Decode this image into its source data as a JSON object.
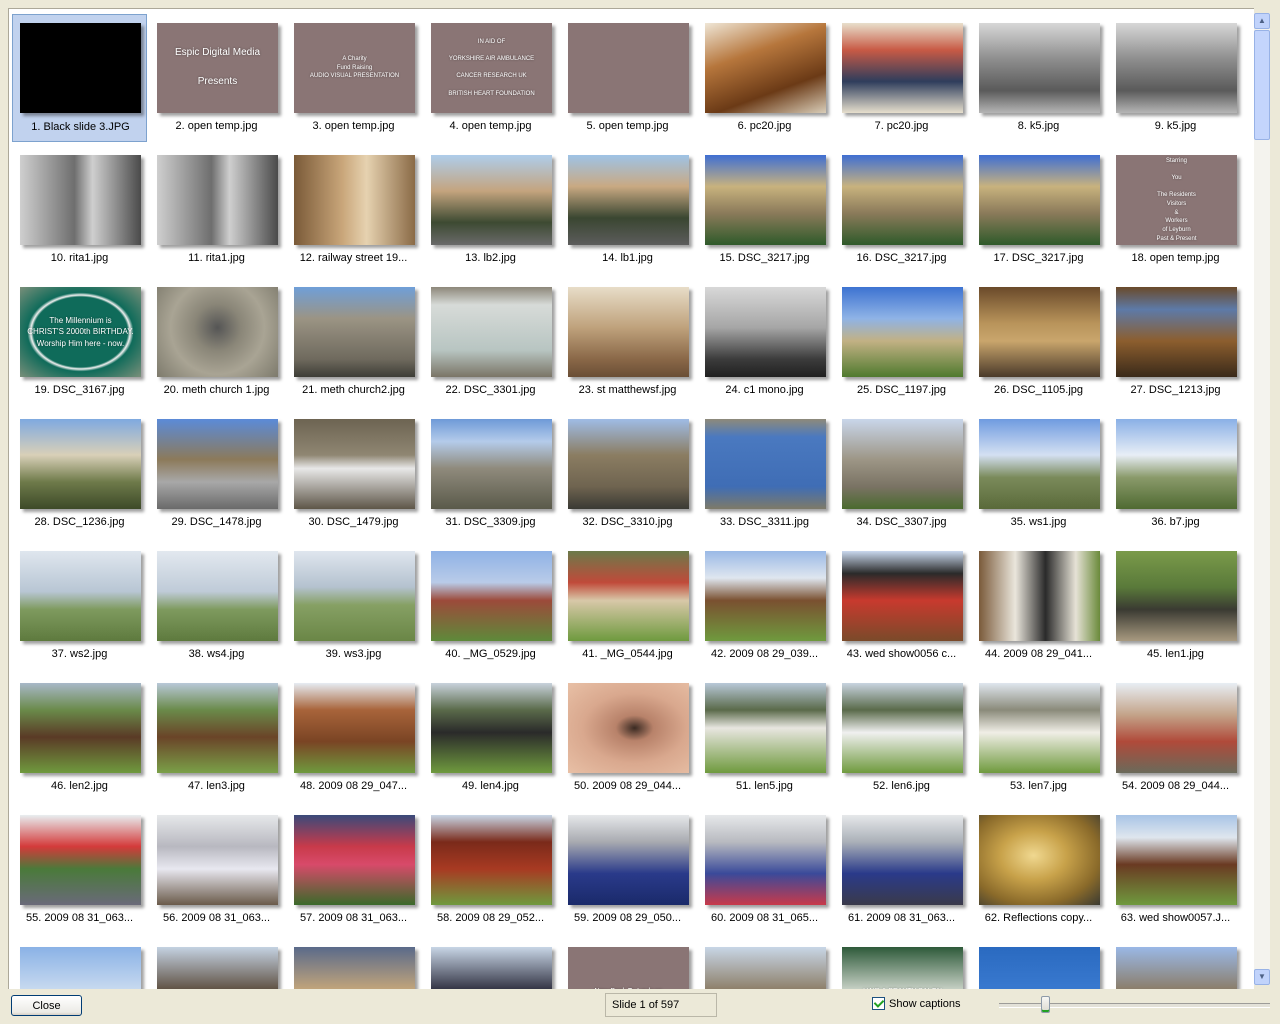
{
  "gallery": {
    "items": [
      {
        "caption": "1. Black slide 3.JPG",
        "selected": true,
        "thumb": {
          "bg": "#000000"
        }
      },
      {
        "caption": "2. open temp.jpg",
        "thumb": {
          "bg": "#8a7575",
          "text": "Espic Digital Media\n\nPresents",
          "font_size": 10
        }
      },
      {
        "caption": "3. open temp.jpg",
        "thumb": {
          "bg": "#8a7575",
          "text": "A Charity\nFund Raising\nAUDIO VISUAL PRESENTATION",
          "font_size": 6
        }
      },
      {
        "caption": "4. open temp.jpg",
        "thumb": {
          "bg": "#8a7575",
          "text": "IN AID OF\n\nYORKSHIRE AIR AMBULANCE\n\nCANCER RESEARCH UK\n\nBRITISH HEART FOUNDATION",
          "font_size": 6
        }
      },
      {
        "caption": "5. open temp.jpg",
        "thumb": {
          "bg": "#8a7575"
        }
      },
      {
        "caption": "6. pc20.jpg",
        "thumb": {
          "bg": "linear-gradient(160deg,#efe6d6 0%,#b6763c 35%,#6b3a16 70%,#d9cdb8 100%)"
        }
      },
      {
        "caption": "7. pc20.jpg",
        "thumb": {
          "bg": "linear-gradient(180deg,#e8dfcc 0%,#c85a45 30%,#2e3d5c 65%,#e7dfcd 100%)"
        }
      },
      {
        "caption": "8. k5.jpg",
        "thumb": {
          "bg": "linear-gradient(180deg,#d7d7d7 0%,#8e8e8e 40%,#5a5a5a 75%,#b5b5b5 100%)"
        }
      },
      {
        "caption": "9. k5.jpg",
        "thumb": {
          "bg": "linear-gradient(180deg,#d7d7d7 0%,#8e8e8e 40%,#5a5a5a 75%,#b5b5b5 100%)"
        }
      },
      {
        "caption": "10. rita1.jpg",
        "thumb": {
          "bg": "linear-gradient(90deg,#cfcfcf 0%,#6e6e6e 45%,#cfcfcf 60%,#4a4a4a 100%)"
        }
      },
      {
        "caption": "11. rita1.jpg",
        "thumb": {
          "bg": "linear-gradient(90deg,#cfcfcf 0%,#6e6e6e 45%,#cfcfcf 60%,#4a4a4a 100%)"
        }
      },
      {
        "caption": "12. railway street 19...",
        "thumb": {
          "bg": "linear-gradient(90deg,#7a5a38 0%,#c9a67a 40%,#e6d2b0 60%,#8a6a46 100%)"
        }
      },
      {
        "caption": "13. lb2.jpg",
        "thumb": {
          "bg": "linear-gradient(180deg,#aecdea 0%,#c4a47e 40%,#3d4a32 75%,#6a6a6a 100%)"
        }
      },
      {
        "caption": "14. lb1.jpg",
        "thumb": {
          "bg": "linear-gradient(180deg,#9ec3e6 0%,#c9a982 35%,#3a4631 70%,#5c5c5c 100%)"
        }
      },
      {
        "caption": "15. DSC_3217.jpg",
        "thumb": {
          "bg": "linear-gradient(180deg,#3f6fd2 0%,#c8b27e 35%,#8a7a5a 65%,#2e5a2a 100%)"
        }
      },
      {
        "caption": "16. DSC_3217.jpg",
        "thumb": {
          "bg": "linear-gradient(180deg,#3f6fd2 0%,#c8b27e 35%,#8a7a5a 65%,#2e5a2a 100%)"
        }
      },
      {
        "caption": "17. DSC_3217.jpg",
        "thumb": {
          "bg": "linear-gradient(180deg,#3f6fd2 0%,#c8b27e 35%,#8a7a5a 65%,#2e5a2a 100%)"
        }
      },
      {
        "caption": "18. open temp.jpg",
        "thumb": {
          "bg": "#8a7575",
          "text": "Starring\n\nYou\n\nThe Residents\nVisitors\n&\nWorkers\nof Leyburn\nPast & Present",
          "font_size": 6
        }
      },
      {
        "caption": "19. DSC_3167.jpg",
        "thumb": {
          "bg": "radial-gradient(ellipse at 50% 50%,#0f6b5a 0%,#0f6b5a 55%,#f0f0f0 58%,#0f6b5a 62%,#7a8f7a 100%)",
          "text": "The Millennium is\nCHRIST'S 2000th BIRTHDAY.\nWorship Him here - now.",
          "font_size": 8
        }
      },
      {
        "caption": "20. meth church 1.jpg",
        "thumb": {
          "bg": "radial-gradient(circle at 50% 45%,#555 0%,#8a8678 30%,#a9a494 60%,#7d7a6c 100%)"
        }
      },
      {
        "caption": "21. meth church2.jpg",
        "thumb": {
          "bg": "linear-gradient(180deg,#6f9fd8 0%,#9b9484 35%,#6f6a5e 80%,#3d3d36 100%)"
        }
      },
      {
        "caption": "22. DSC_3301.jpg",
        "thumb": {
          "bg": "linear-gradient(180deg,#8d877a 0%,#d7dbd8 20%,#b8c5c2 70%,#7a7466 100%)"
        }
      },
      {
        "caption": "23. st matthewsf.jpg",
        "thumb": {
          "bg": "linear-gradient(180deg,#e8ddc8 0%,#bfa27c 45%,#8a6848 80%,#6a4e36 100%)"
        }
      },
      {
        "caption": "24. c1 mono.jpg",
        "thumb": {
          "bg": "linear-gradient(180deg,#d8d8d8 0%,#a6a6a6 45%,#3c3c3c 80%,#202020 100%)"
        }
      },
      {
        "caption": "25. DSC_1197.jpg",
        "thumb": {
          "bg": "linear-gradient(180deg,#3d73d1 0%,#8fb3e6 35%,#c2b184 60%,#4f7a2e 100%)"
        }
      },
      {
        "caption": "26. DSC_1105.jpg",
        "thumb": {
          "bg": "linear-gradient(180deg,#6a4a2a 0%,#b8935a 40%,#c9a56c 60%,#4a3a2a 100%)"
        }
      },
      {
        "caption": "27. DSC_1213.jpg",
        "thumb": {
          "bg": "linear-gradient(180deg,#6a4a2a 0%,#5d7aa8 25%,#8c5e2e 60%,#3a2a1a 100%)"
        }
      },
      {
        "caption": "28. DSC_1236.jpg",
        "thumb": {
          "bg": "linear-gradient(180deg,#7fa9e0 0%,#d9d0b8 40%,#6e7a4a 70%,#3d4a28 100%)"
        }
      },
      {
        "caption": "29. DSC_1478.jpg",
        "thumb": {
          "bg": "linear-gradient(180deg,#5b8bd8 0%,#8c7a5a 45%,#a8a8a8 70%,#6a6a6a 100%)"
        }
      },
      {
        "caption": "30. DSC_1479.jpg",
        "thumb": {
          "bg": "linear-gradient(180deg,#6d6452 0%,#8f8672 40%,#e8e8e8 55%,#5e5648 100%)"
        }
      },
      {
        "caption": "31. DSC_3309.jpg",
        "thumb": {
          "bg": "linear-gradient(180deg,#6e9ad8 0%,#b4cbea 25%,#8f8a7c 55%,#5a5a4a 100%)"
        }
      },
      {
        "caption": "32. DSC_3310.jpg",
        "thumb": {
          "bg": "linear-gradient(180deg,#9fbce6 0%,#8b7d62 40%,#6f6450 75%,#3a3a34 100%)"
        }
      },
      {
        "caption": "33. DSC_3311.jpg",
        "thumb": {
          "bg": "linear-gradient(180deg,#8e8a7a 0%,#4a79c0 20%,#3f6db5 75%,#7e7a68 100%)"
        }
      },
      {
        "caption": "34. DSC_3307.jpg",
        "thumb": {
          "bg": "linear-gradient(180deg,#c9d6ea 0%,#9d9686 45%,#7a7364 75%,#4a6a2e 100%)"
        }
      },
      {
        "caption": "35. ws1.jpg",
        "thumb": {
          "bg": "linear-gradient(180deg,#6f9be0 0%,#d4e0f2 40%,#7a8a5a 65%,#5a6a3a 100%)"
        }
      },
      {
        "caption": "36. b7.jpg",
        "thumb": {
          "bg": "linear-gradient(180deg,#8ab0e6 0%,#e8eef6 40%,#8a9a6a 65%,#4f6a32 100%)"
        }
      },
      {
        "caption": "37. ws2.jpg",
        "thumb": {
          "bg": "linear-gradient(180deg,#dfe6ee 0%,#b8c6d4 45%,#7e9a5e 65%,#5e7a3e 100%)"
        }
      },
      {
        "caption": "38. ws4.jpg",
        "thumb": {
          "bg": "linear-gradient(180deg,#e2e8ef 0%,#bfcbd8 45%,#7e9a5e 65%,#5e7a3e 100%)"
        }
      },
      {
        "caption": "39. ws3.jpg",
        "thumb": {
          "bg": "linear-gradient(180deg,#dfe6ee 0%,#b4c2cf 40%,#86a064 60%,#6a8646 100%)"
        }
      },
      {
        "caption": "40. _MG_0529.jpg",
        "thumb": {
          "bg": "linear-gradient(180deg,#8fb2e6 0%,#b9cbe8 35%,#9c4a3a 55%,#5e8a3a 100%)"
        }
      },
      {
        "caption": "41. _MG_0544.jpg",
        "thumb": {
          "bg": "linear-gradient(180deg,#6b7a4a 0%,#c04a3a 35%,#d8c8a8 55%,#6e9a3e 100%)"
        }
      },
      {
        "caption": "42. 2009 08 29_039...",
        "thumb": {
          "bg": "linear-gradient(180deg,#9ab9e6 0%,#dfe6ef 30%,#7a5030 55%,#6f9a3e 100%)"
        }
      },
      {
        "caption": "43. wed show0056 c...",
        "thumb": {
          "bg": "linear-gradient(180deg,#c9d8ee 0%,#2a2a2a 25%,#c83a2e 55%,#7a4a2a 100%)"
        }
      },
      {
        "caption": "44. 2009 08 29_041...",
        "thumb": {
          "bg": "linear-gradient(90deg,#7a5a3a 0%,#eae6dc 30%,#2a2a2a 55%,#e6e2d6 80%,#6a8a3a 100%)"
        }
      },
      {
        "caption": "45. len1.jpg",
        "thumb": {
          "bg": "linear-gradient(180deg,#7a9a4a 0%,#5a7a3a 40%,#3a3a32 65%,#a89a80 100%)"
        }
      },
      {
        "caption": "46. len2.jpg",
        "thumb": {
          "bg": "linear-gradient(180deg,#a8b8c8 0%,#6a8a4a 30%,#5a3a26 60%,#6f9a3e 100%)"
        }
      },
      {
        "caption": "47. len3.jpg",
        "thumb": {
          "bg": "linear-gradient(180deg,#b8c8d8 0%,#6a8a4a 30%,#6a4428 60%,#7aa048 100%)"
        }
      },
      {
        "caption": "48. 2009 08 29_047...",
        "thumb": {
          "bg": "linear-gradient(180deg,#e6ecf2 0%,#a8643a 30%,#7a4424 65%,#6f9a3e 100%)"
        }
      },
      {
        "caption": "49. len4.jpg",
        "thumb": {
          "bg": "linear-gradient(180deg,#c8d2dc 0%,#5a6a4a 30%,#2a2a2a 55%,#6f9a3e 100%)"
        }
      },
      {
        "caption": "50. 2009 08 29_044...",
        "thumb": {
          "bg": "radial-gradient(ellipse at 55% 50%,#3a2a22 0%,#b8826a 20%,#d9a88e 55%,#e8c0a6 100%)"
        }
      },
      {
        "caption": "51. len5.jpg",
        "thumb": {
          "bg": "linear-gradient(180deg,#b8c8d8 0%,#5a6a4a 30%,#e8e6e0 50%,#6f9a3e 100%)"
        }
      },
      {
        "caption": "52. len6.jpg",
        "thumb": {
          "bg": "linear-gradient(180deg,#c8d4e0 0%,#5a6a4a 30%,#f0f0f0 55%,#6f9a3e 100%)"
        }
      },
      {
        "caption": "53. len7.jpg",
        "thumb": {
          "bg": "linear-gradient(180deg,#dfe6ee 0%,#8a8a7a 30%,#f0eee6 55%,#6f9a3e 100%)"
        }
      },
      {
        "caption": "54. 2009 08 29_044...",
        "thumb": {
          "bg": "linear-gradient(180deg,#e8eef4 0%,#c4a48a 35%,#b04a3a 65%,#6a6a5a 100%)"
        }
      },
      {
        "caption": "55. 2009 08 31_063...",
        "thumb": {
          "bg": "linear-gradient(180deg,#e8eef0 0%,#d43a3a 35%,#4a7a3a 60%,#6a6a7a 100%)"
        }
      },
      {
        "caption": "56. 2009 08 31_063...",
        "thumb": {
          "bg": "linear-gradient(180deg,#e6e8ea 0%,#b8b8c0 35%,#e8e8f0 60%,#6a5a4a 100%)"
        }
      },
      {
        "caption": "57. 2009 08 31_063...",
        "thumb": {
          "bg": "linear-gradient(180deg,#3a4a7a 0%,#c83a4a 35%,#d84a6a 55%,#3a6a2a 100%)"
        }
      },
      {
        "caption": "58. 2009 08 29_052...",
        "thumb": {
          "bg": "linear-gradient(180deg,#c8d6e6 0%,#7a2a1a 30%,#a83a22 60%,#6f9a3e 100%)"
        }
      },
      {
        "caption": "59. 2009 08 29_050...",
        "thumb": {
          "bg": "linear-gradient(180deg,#e6e8ea 0%,#a8aab0 30%,#2a3a8a 65%,#1a2a6a 100%)"
        }
      },
      {
        "caption": "60. 2009 08 31_065...",
        "thumb": {
          "bg": "linear-gradient(180deg,#e6e8ea 0%,#b8bac0 30%,#3a4a9a 65%,#c83a4a 100%)"
        }
      },
      {
        "caption": "61. 2009 08 31_063...",
        "thumb": {
          "bg": "linear-gradient(180deg,#e6e8ea 0%,#aab0b8 30%,#2a3a8a 65%,#3a3a4a 100%)"
        }
      },
      {
        "caption": "62. Reflections copy...",
        "thumb": {
          "bg": "radial-gradient(ellipse at 45% 45%,#f0d890 0%,#c8a24a 35%,#8a6a2a 70%,#3a3a32 100%)"
        }
      },
      {
        "caption": "63. wed show0057.J...",
        "thumb": {
          "bg": "linear-gradient(180deg,#a8c4e6 0%,#dfe6ee 25%,#6a3a22 55%,#6f9a3e 100%)"
        }
      },
      {
        "caption": "",
        "thumb": {
          "bg": "linear-gradient(180deg,#8ab2e6 0%,#d8e4f2 60%,#e8eef4 100%)"
        }
      },
      {
        "caption": "",
        "thumb": {
          "bg": "linear-gradient(180deg,#c4d2e2 0%,#5a4a3a 50%,#7a6a5a 100%)"
        }
      },
      {
        "caption": "",
        "thumb": {
          "bg": "linear-gradient(180deg,#5a6a8a 0%,#c8a87a 50%,#7a6a5a 100%)"
        }
      },
      {
        "caption": "",
        "thumb": {
          "bg": "linear-gradient(180deg,#c8d6e6 0%,#2a2a3a 50%,#5a5a5a 100%)"
        }
      },
      {
        "caption": "",
        "thumb": {
          "bg": "#8a7575",
          "text": "Now Back To Leyburn",
          "font_size": 7
        }
      },
      {
        "caption": "",
        "thumb": {
          "bg": "linear-gradient(180deg,#c8d6e6 0%,#8a7a62 50%,#6a5a4a 100%)"
        }
      },
      {
        "caption": "",
        "thumb": {
          "bg": "linear-gradient(180deg,#2e5a3a 0%,#e0e4dc 55%,#8a8a7a 100%)",
          "text": "HAIR & BEAUTY SALON",
          "font_size": 7
        }
      },
      {
        "caption": "",
        "thumb": {
          "bg": "linear-gradient(180deg,#2a6ac0 0%,#3a7ad0 50%,#8a8a7a 100%)"
        }
      },
      {
        "caption": "",
        "thumb": {
          "bg": "linear-gradient(180deg,#9ab8e6 0%,#8a7a62 50%,#6a5a4a 100%)"
        }
      }
    ]
  },
  "footer": {
    "close_label": "Close",
    "status": "Slide 1 of 597",
    "show_captions_label": "Show captions",
    "show_captions_checked": true,
    "thumbnail_size_fraction": 0.16
  },
  "icons": {
    "scroll_up": "arrow-up-icon",
    "scroll_down": "arrow-down-icon",
    "checkbox": "checkmark-icon"
  }
}
